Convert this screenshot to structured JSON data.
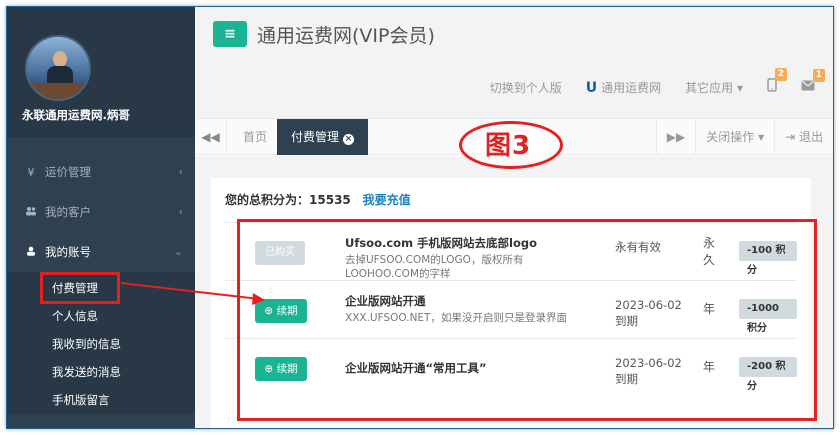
{
  "profile": {
    "name": "永联通用运费网.炳哥"
  },
  "sidebar": {
    "items": [
      {
        "label": "运价管理",
        "icon": "yen-icon"
      },
      {
        "label": "我的客户",
        "icon": "users-icon"
      },
      {
        "label": "我的账号",
        "icon": "user-icon"
      }
    ],
    "account_subitems": [
      "付费管理",
      "个人信息",
      "我收到的信息",
      "我发送的消息",
      "手机版留言"
    ]
  },
  "header": {
    "menu_button": "≡",
    "title": "通用运费网(VIP会员)",
    "switch_personal": "切换到个人版",
    "brand_link": "通用运费网",
    "other_apps": "其它应用",
    "phone_badge": "2",
    "mail_badge": "1"
  },
  "tabs": {
    "home": "首页",
    "active": "付费管理",
    "close_ops": "关闭操作",
    "logout": "退出"
  },
  "annotation": {
    "label": "图3"
  },
  "panel": {
    "points_label": "您的总积分为：",
    "points_value": "15535",
    "recharge_link": "我要充值"
  },
  "rows": [
    {
      "button": "已购买",
      "title": "Ufsoo.com 手机版网站去底部logo",
      "desc": "去掉UFSOO.COM的LOGO，版权所有LOOHOO.COM的字样",
      "valid": "永有有效",
      "unit": "永久",
      "cost": "-100 积分"
    },
    {
      "button": "续期",
      "title": "企业版网站开通",
      "desc": "XXX.UFSOO.NET，如果没开启则只是登录界面",
      "valid": "2023-06-02到期",
      "unit": "年",
      "cost": "-1000 积分"
    },
    {
      "button": "续期",
      "title": "企业版网站开通“常用工具”",
      "desc": "",
      "valid": "2023-06-02到期",
      "unit": "年",
      "cost": "-200 积分"
    }
  ],
  "colors": {
    "sidebar_bg": "#2f4050",
    "accent_green": "#1ab394",
    "annotation_red": "#e42121",
    "link_blue": "#1c84c6"
  }
}
